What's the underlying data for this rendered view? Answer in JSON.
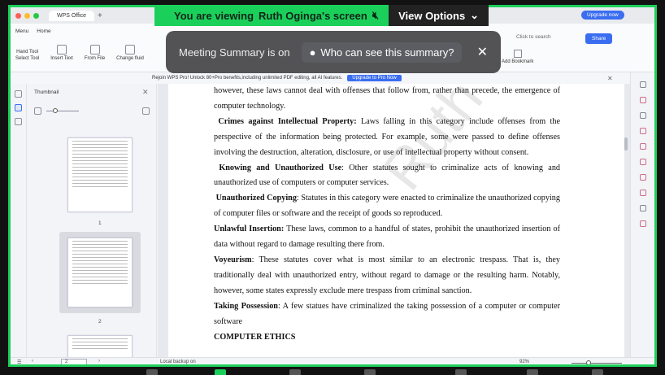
{
  "zoom": {
    "banner_prefix": "You are viewing",
    "presenter_screen": "Ruth Oginga's screen",
    "view_options": "View Options",
    "summary_label": "Meeting Summary is on",
    "summary_pill": "Who can see this summary?",
    "colors": {
      "accent": "#1bd05a",
      "overlay": "#464648"
    }
  },
  "browser": {
    "tab": "WPS Office",
    "upgrade": "Upgrade now"
  },
  "wps": {
    "menu": [
      "Menu",
      "Home"
    ],
    "tools": [
      "Hand Tool",
      "Select Tool",
      "Insert Text",
      "From File",
      "Change fluid"
    ],
    "search": "Click to search",
    "share": "Share",
    "bookmark": "Add Bookmark",
    "promo_text": "Rejoin WPS Pro! Unlock 80+Pro benefits,including unlimited PDF editing, all AI features.",
    "promo_button": "Upgrade to Pro Now",
    "thumbnail_title": "Thumbnail",
    "page_numbers": [
      "1",
      "2"
    ],
    "current_page": "2",
    "backup": "Local backup on",
    "zoom_level": "92%"
  },
  "doc": {
    "line0": "however, these laws cannot deal with offenses that follow from, rather than precede, the emergence of computer technology.",
    "p1_head": "Crimes against Intellectual Property:",
    "p1_body": " Laws falling in this category include offenses from the perspective of the information being protected. For example, some were passed to define offenses involving the destruction, alteration, disclosure, or use of intellectual property without consent.",
    "p2_head": "Knowing and Unauthorized Use",
    "p2_body": ": Other statutes sought to criminalize acts of knowing and unauthorized use of computers or computer services.",
    "p3_head": "Unauthorized Copying",
    "p3_body": ": Statutes in this category were enacted to criminalize the unauthorized copying of computer files or software and the receipt of goods so reproduced.",
    "p4_head": "Unlawful Insertion:",
    "p4_body": " These laws, common to a handful of states, prohibit the unauthorized insertion of data without regard to damage resulting there from.",
    "p5_head": "Voyeurism",
    "p5_body": ": These statutes cover what is most similar to an electronic trespass. That is, they traditionally deal with unauthorized entry, without regard to damage or the resulting harm. Notably, however, some states expressly exclude mere trespass from criminal sanction.",
    "p6_head": "Taking Possession",
    "p6_body": ": A few statues have criminalized the taking possession of a computer or computer software",
    "heading": "COMPUTER ETHICS",
    "watermark": "Ruth Oginga"
  }
}
